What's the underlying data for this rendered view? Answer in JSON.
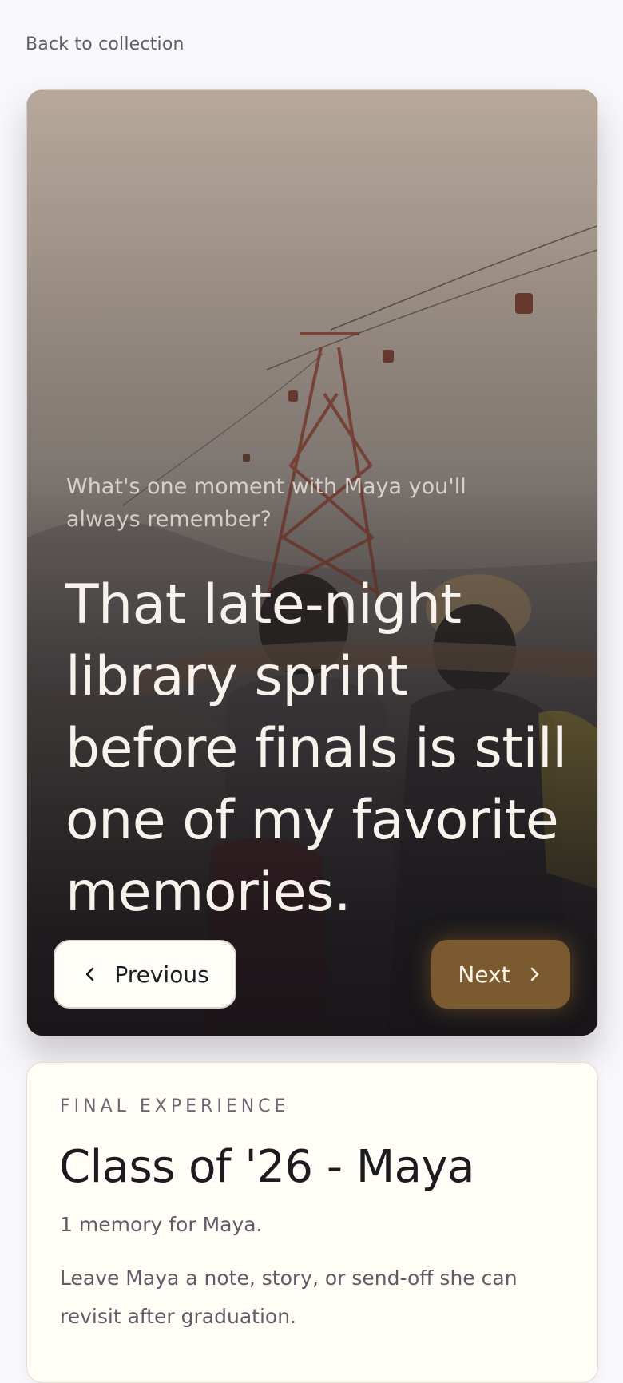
{
  "nav": {
    "back_label": "Back to collection"
  },
  "story": {
    "question": "What's one moment with Maya you'll always remember?",
    "answer": "That late-night library sprint before finals is still one of my favorite memories.",
    "previous_label": "Previous",
    "next_label": "Next",
    "accent_color": "#7b5a2f"
  },
  "experience": {
    "eyebrow": "FINAL EXPERIENCE",
    "title": "Class of '26 - Maya",
    "count_text": "1 memory for Maya.",
    "description": "Leave Maya a note, story, or send-off she can revisit after graduation."
  },
  "icons": [
    "chevron-left-icon",
    "chevron-right-icon"
  ]
}
